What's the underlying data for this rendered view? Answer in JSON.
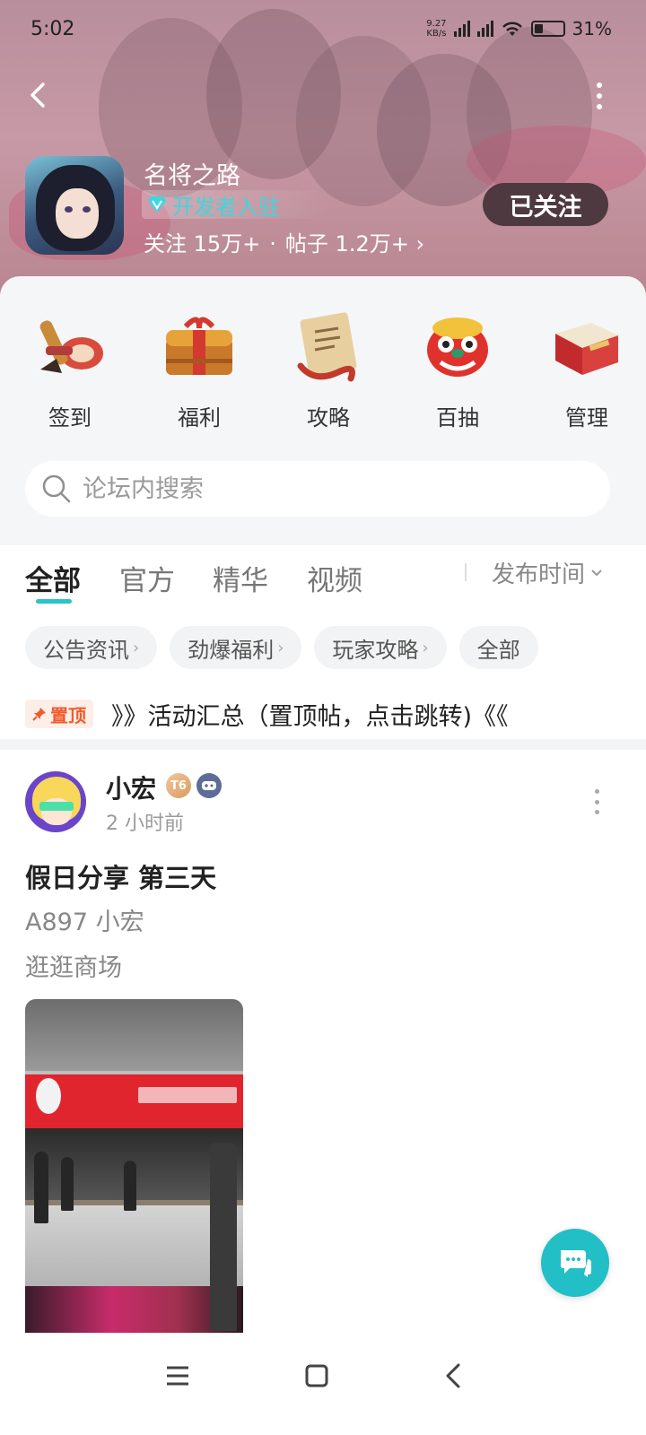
{
  "status_bar": {
    "time": "5:02",
    "net_speed_value": "9.27",
    "net_speed_unit": "KB/s",
    "battery": "31%"
  },
  "forum": {
    "name": "名将之路",
    "badge": "开发者入驻",
    "stats_follow": "关注 15万+",
    "stats_separator": "·",
    "stats_posts": "帖子 1.2万+",
    "follow_button": "已关注"
  },
  "quick_actions": [
    {
      "label": "签到",
      "icon": "brush-scroll-icon"
    },
    {
      "label": "福利",
      "icon": "treasure-chest-icon"
    },
    {
      "label": "攻略",
      "icon": "scroll-map-icon"
    },
    {
      "label": "百抽",
      "icon": "lion-dance-icon"
    },
    {
      "label": "管理",
      "icon": "red-book-icon"
    }
  ],
  "search": {
    "placeholder": "论坛内搜索"
  },
  "tabs": [
    "全部",
    "官方",
    "精华",
    "视频"
  ],
  "sort_label": "发布时间",
  "chips": [
    "公告资讯",
    "劲爆福利",
    "玩家攻略",
    "全部"
  ],
  "pinned": {
    "tag": "置顶",
    "title": "》》活动汇总（置顶帖，点击跳转)《《"
  },
  "post": {
    "author": "小宏",
    "level": "T6",
    "time": "2 小时前",
    "title": "假日分享 第三天",
    "line1": "A897 小宏",
    "line2": "逛逛商场"
  },
  "colors": {
    "accent": "#2ac3c8",
    "pin": "#f15a2c",
    "follow_bg": "#4e3941"
  }
}
